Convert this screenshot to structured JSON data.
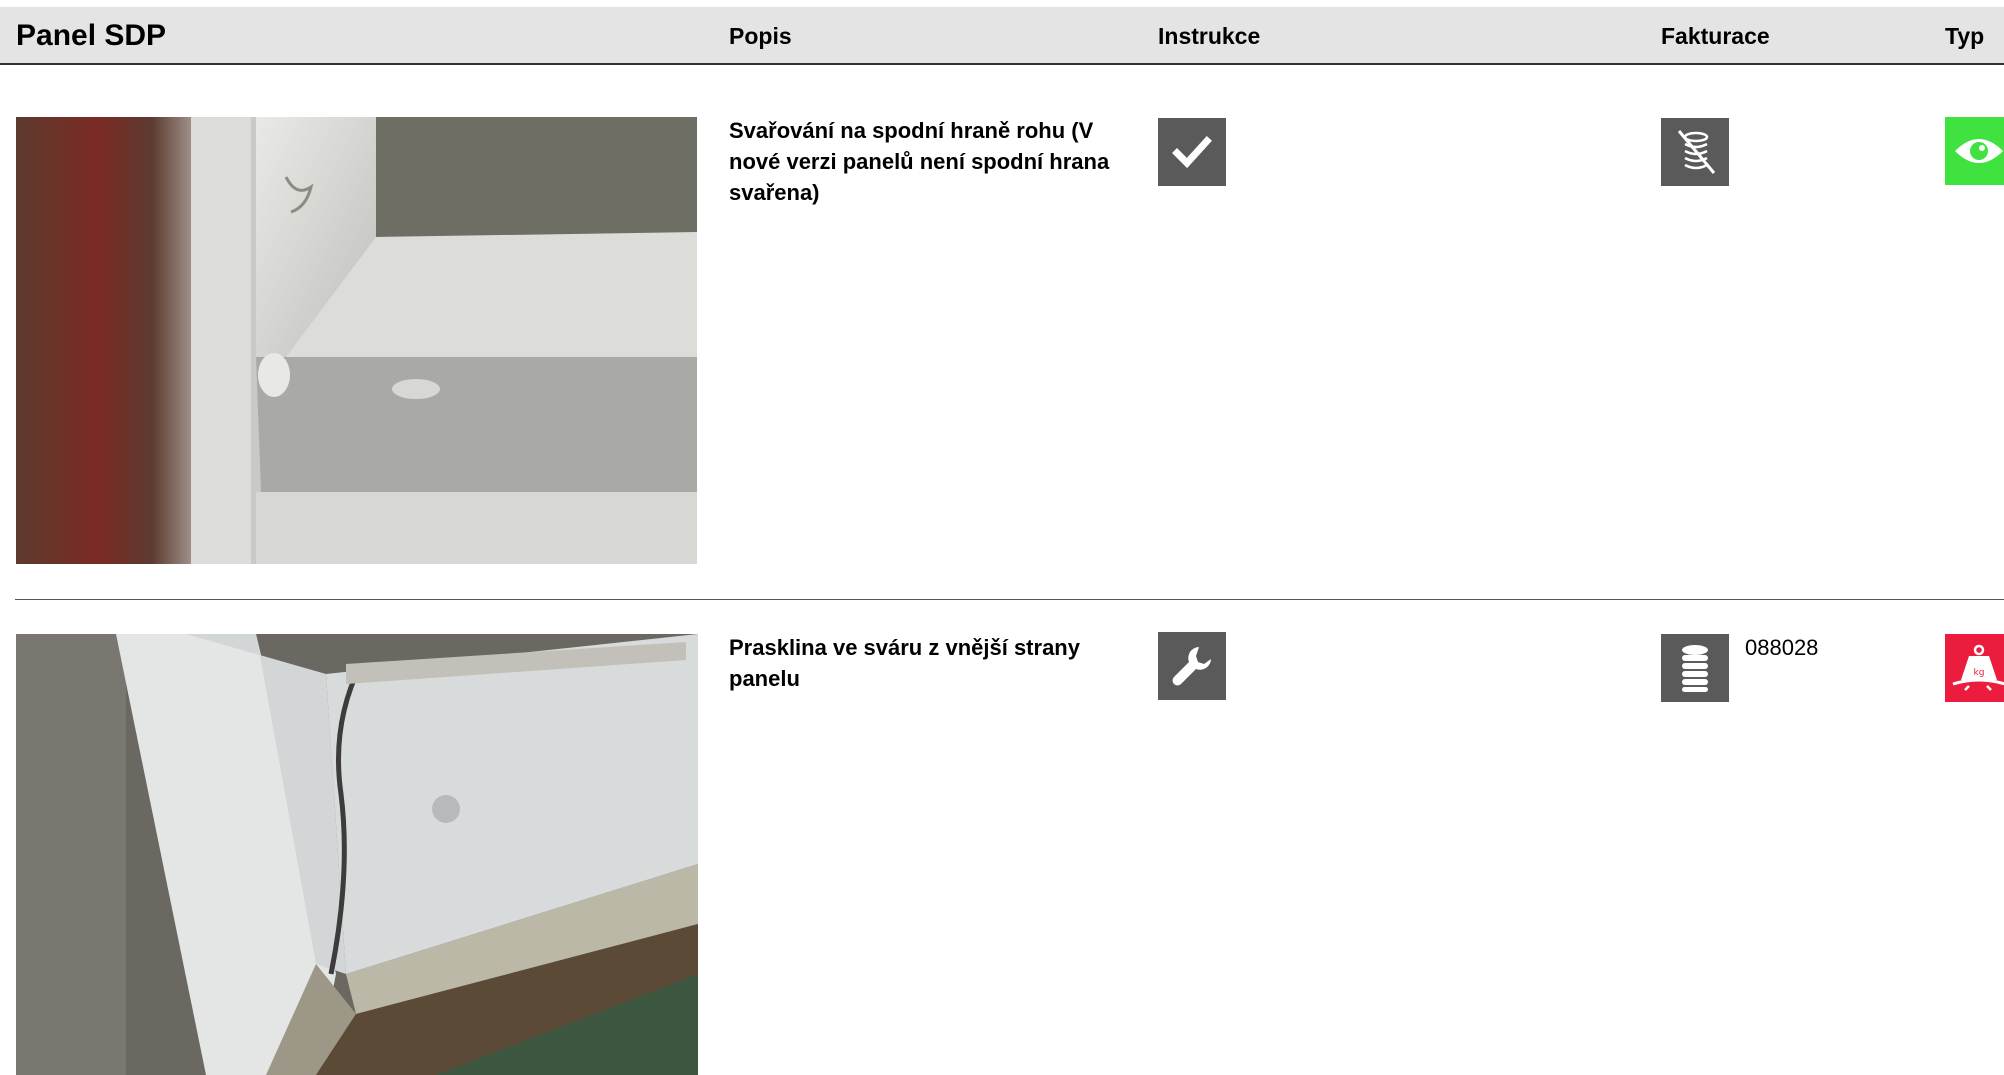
{
  "header": {
    "title": "Panel SDP",
    "columns": {
      "popis": "Popis",
      "instrukce": "Instrukce",
      "fakturace": "Fakturace",
      "typ": "Typ"
    }
  },
  "rows": [
    {
      "description": "Svařování na spodní hraně rohu (V nové verzi panelů není spodní hrana svařena)",
      "instruction_icon": "checkmark-icon",
      "billing_icon": "no-billing-coins-icon",
      "billing_code": "",
      "type_icon": "eye-icon",
      "type_color": "#3fe23f"
    },
    {
      "description": "Prasklina ve sváru z vnější strany panelu",
      "instruction_icon": "wrench-icon",
      "billing_icon": "billing-coins-icon",
      "billing_code": "088028",
      "type_icon": "weight-kg-icon",
      "type_color": "#ec1c3e"
    }
  ],
  "colors": {
    "header_bg": "#e4e4e4",
    "icon_dark": "#5a5a5a"
  }
}
